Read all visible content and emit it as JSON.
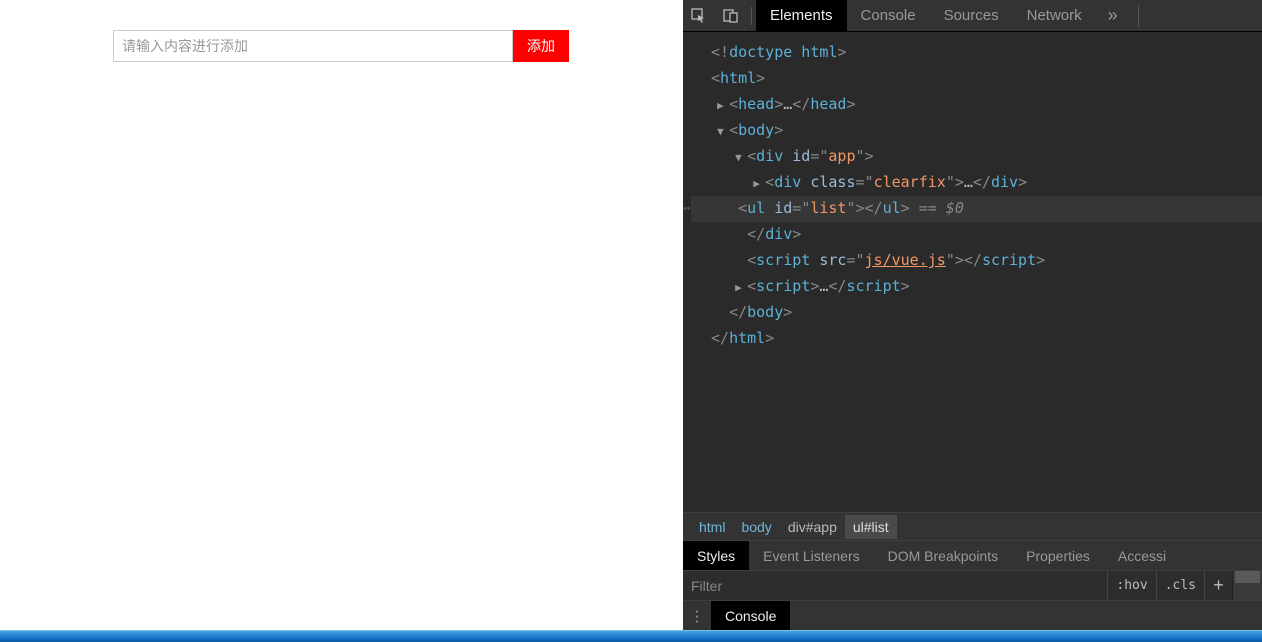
{
  "page": {
    "input_placeholder": "请输入内容进行添加",
    "add_button": "添加"
  },
  "devtools": {
    "tabs": [
      "Elements",
      "Console",
      "Sources",
      "Network"
    ],
    "active_tab": 0,
    "more_glyph": "»",
    "dom": {
      "doctype": "<!doctype html>",
      "html_open": "html",
      "head": "head",
      "body": "body",
      "div_app_id": "app",
      "div_clearfix_class": "clearfix",
      "ul_list_id": "list",
      "selected_suffix": " == $0",
      "script_src": "js/vue.js",
      "script2": "script"
    },
    "breadcrumb": [
      "html",
      "body",
      "div#app",
      "ul#list"
    ],
    "styles_tabs": [
      "Styles",
      "Event Listeners",
      "DOM Breakpoints",
      "Properties",
      "Accessi"
    ],
    "filter_placeholder": "Filter",
    "hov": ":hov",
    "cls": ".cls",
    "plus": "+",
    "console_drawer": "Console"
  }
}
